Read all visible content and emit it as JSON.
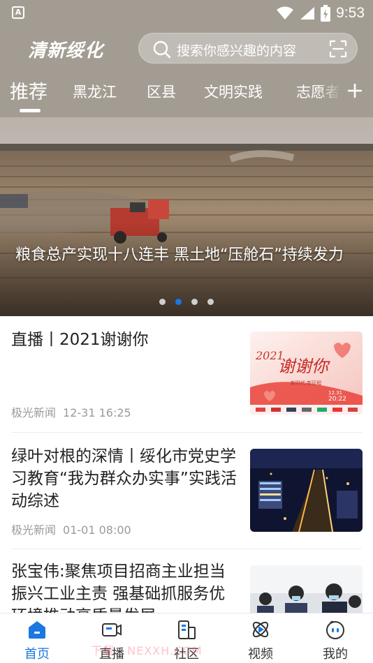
{
  "status_bar": {
    "time": "9:53",
    "app_icon": "A"
  },
  "header": {
    "logo": "清新绥化",
    "search": {
      "placeholder": "搜索你感兴趣的内容"
    }
  },
  "tabs": [
    {
      "label": "推荐",
      "active": true
    },
    {
      "label": "黑龙江"
    },
    {
      "label": "区县"
    },
    {
      "label": "文明实践"
    },
    {
      "label": "志愿者"
    }
  ],
  "banner": {
    "caption": "粮食总产实现十八连丰 黑土地“压舱石”持续发力",
    "slide_count": 4,
    "active_slide": 2
  },
  "news": [
    {
      "title": "直播丨2021谢谢你",
      "source": "极光新闻",
      "time": "12-31 16:25",
      "thumb_text": {
        "year": "2021",
        "main": "谢谢你",
        "sub": "新时代·新征程",
        "date": "12.31",
        "clock": "20:22"
      }
    },
    {
      "title": "绿叶对根的深情丨绥化市党史学习教育“我为群众办实事”实践活动综述",
      "source": "极光新闻",
      "time": "01-01 08:00"
    },
    {
      "title": "张宝伟:聚焦项目招商主业担当振兴工业主责 强基础抓服务优环境推动高质量发展",
      "source": "",
      "time": ""
    }
  ],
  "bottom_nav": [
    {
      "label": "首页",
      "icon": "home-icon",
      "active": true
    },
    {
      "label": "直播",
      "icon": "live-camera-icon"
    },
    {
      "label": "社区",
      "icon": "community-building-icon"
    },
    {
      "label": "视频",
      "icon": "video-play-icon"
    },
    {
      "label": "我的",
      "icon": "profile-face-icon"
    }
  ],
  "watermark": "下载 · NEXXH.COM",
  "colors": {
    "header_bg": "#a39c92",
    "accent": "#1a78e0",
    "meta_text": "#9a9a9a"
  }
}
